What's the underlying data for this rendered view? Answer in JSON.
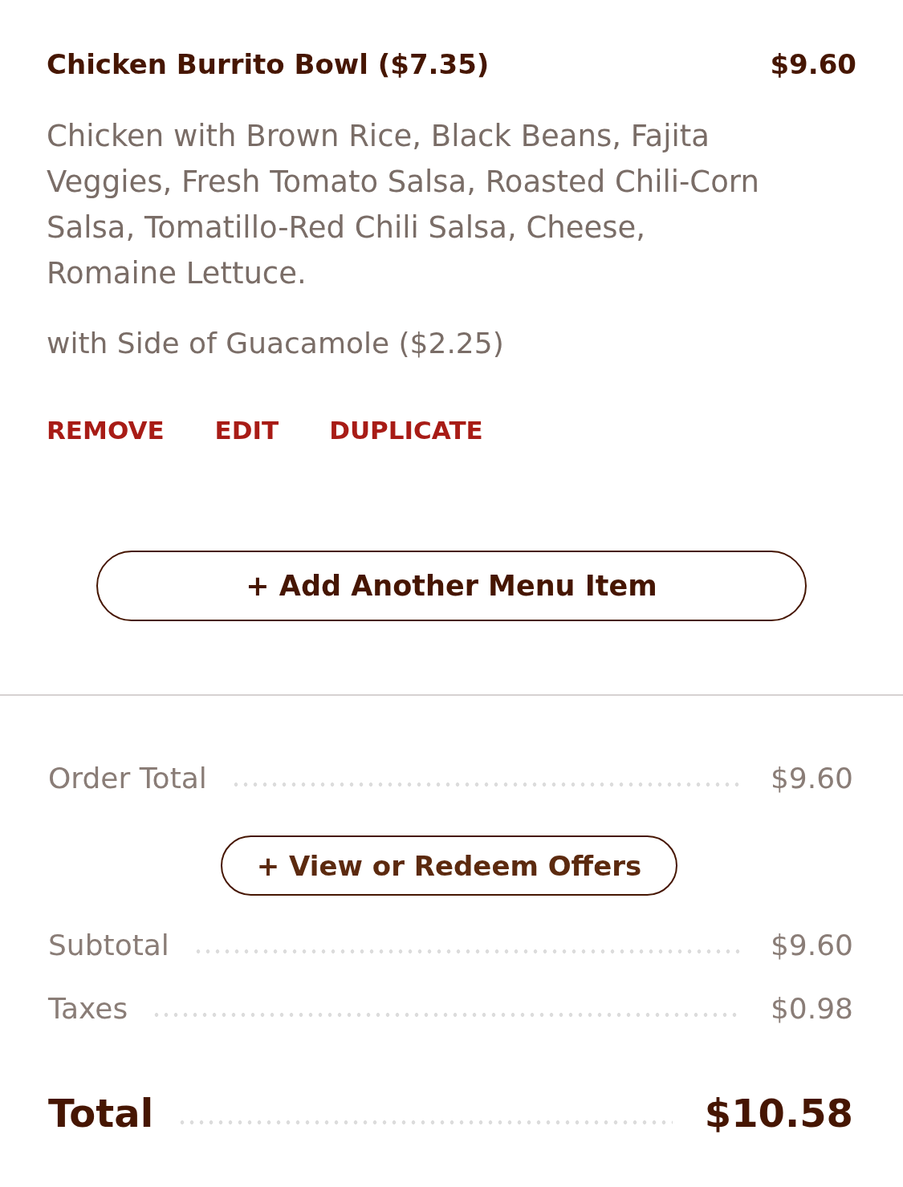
{
  "item": {
    "name": "Chicken Burrito Bowl ($7.35)",
    "price": "$9.60",
    "description": "Chicken with Brown Rice, Black Beans, Fajita Veggies, Fresh Tomato Salsa, Roasted Chili-Corn Salsa, Tomatillo-Red Chili Salsa, Cheese, Romaine Lettuce.",
    "side": "with Side of Guacamole ($2.25)",
    "actions": [
      "REMOVE",
      "EDIT",
      "DUPLICATE"
    ]
  },
  "add_button": "+ Add Another Menu Item",
  "summary": [
    {
      "kind": "row",
      "label": "Order Total",
      "value": "$9.60"
    },
    {
      "kind": "button",
      "label": "+ View or Redeem Offers"
    },
    {
      "kind": "row",
      "label": "Subtotal",
      "value": "$9.60"
    },
    {
      "kind": "row",
      "label": "Taxes",
      "value": "$0.98"
    },
    {
      "kind": "total",
      "label": "Total",
      "value": "$10.58"
    }
  ]
}
